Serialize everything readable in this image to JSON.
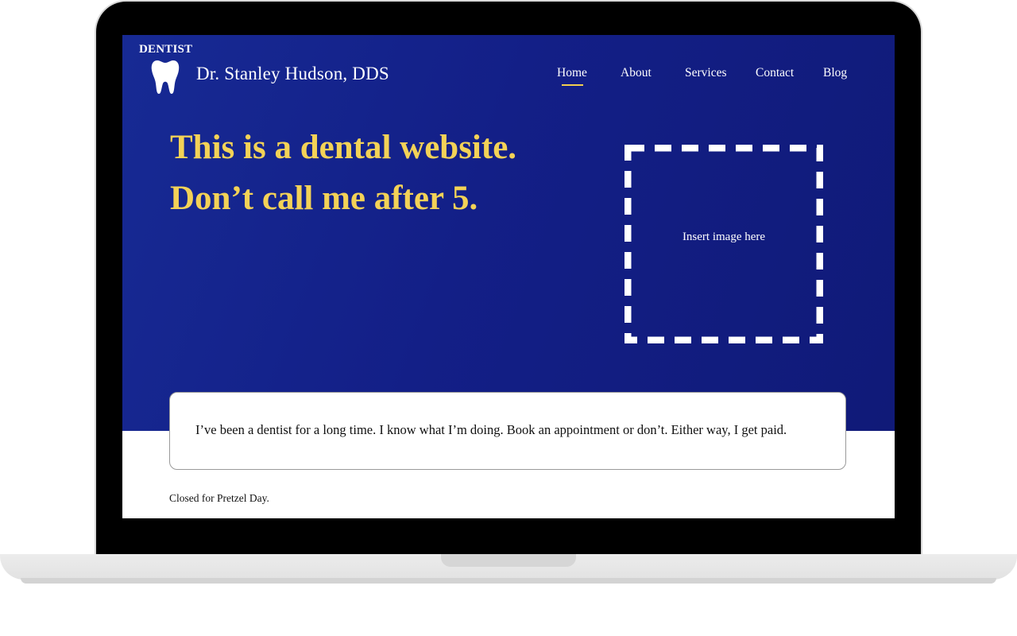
{
  "brand": {
    "tag": "DENTIST",
    "name": "Dr. Stanley Hudson, DDS",
    "icon": "tooth-icon"
  },
  "nav": {
    "items": [
      {
        "label": "Home",
        "active": true
      },
      {
        "label": "About",
        "active": false
      },
      {
        "label": "Services",
        "active": false
      },
      {
        "label": "Contact",
        "active": false
      },
      {
        "label": "Blog",
        "active": false
      }
    ]
  },
  "hero": {
    "headline": "This is a dental website. Don’t call me after 5.",
    "image_placeholder": "Insert image here"
  },
  "quote": {
    "text": "I’ve been a dentist for a long time. I know what I’m doing. Book an appointment or don’t. Either way, I get paid."
  },
  "footer": {
    "note": "Closed for Pretzel Day."
  },
  "colors": {
    "hero_blue": "#131f87",
    "headline_yellow": "#f3d257",
    "active_underline": "#f2cf4f"
  }
}
